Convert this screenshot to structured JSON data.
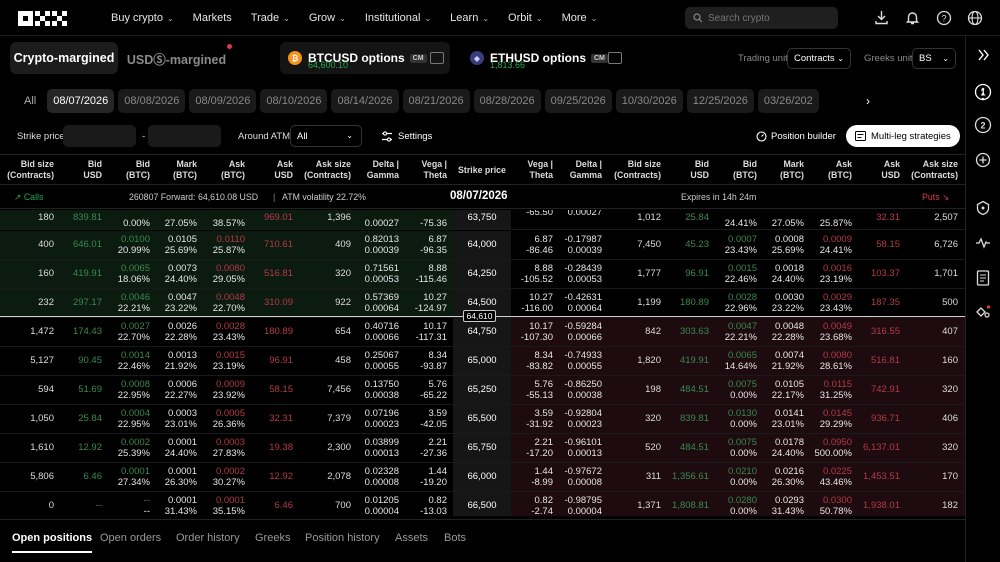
{
  "nav": {
    "items": [
      "Buy crypto",
      "Markets",
      "Trade",
      "Grow",
      "Institutional",
      "Learn",
      "Orbit",
      "More"
    ],
    "has_chevron": [
      true,
      false,
      true,
      true,
      true,
      true,
      true,
      true
    ],
    "search_placeholder": "Search crypto"
  },
  "margin_tabs": {
    "crypto": "Crypto-margined",
    "usd": "USDⓈ-margined"
  },
  "pairs": [
    {
      "name": "BTCUSD options",
      "badge": "CM",
      "price": "64,600.10"
    },
    {
      "name": "ETHUSD options",
      "badge": "CM",
      "price": "1,813.66"
    }
  ],
  "units": {
    "trading_label": "Trading unit",
    "trading_value": "Contracts",
    "greeks_label": "Greeks unit",
    "greeks_value": "BS"
  },
  "dates": [
    "All",
    "08/07/2026",
    "08/08/2026",
    "08/09/2026",
    "08/10/2026",
    "08/14/2026",
    "08/21/2026",
    "08/28/2026",
    "09/25/2026",
    "10/30/2026",
    "12/25/2026",
    "03/26/202"
  ],
  "active_date_index": 1,
  "filters": {
    "strike_label": "Strike price",
    "dash": "-",
    "atm_label": "Around ATM",
    "atm_value": "All",
    "settings": "Settings",
    "position_builder": "Position builder",
    "multi_leg": "Multi-leg strategies"
  },
  "columns": {
    "call": [
      "Bid size\n(Contracts)",
      "Bid\nUSD",
      "Bid\n(BTC)",
      "Mark\n(BTC)",
      "Ask\n(BTC)",
      "Ask\nUSD",
      "Ask size\n(Contracts)",
      "Delta |\nGamma",
      "Vega |\nTheta"
    ],
    "strike": "Strike price",
    "put": [
      "Vega |\nTheta",
      "Delta |\nGamma",
      "Bid size\n(Contracts)",
      "Bid\nUSD",
      "Bid\n(BTC)",
      "Mark\n(BTC)",
      "Ask\n(BTC)",
      "Ask\nUSD",
      "Ask size\n(Contracts)"
    ]
  },
  "infobar": {
    "calls": "Calls",
    "forward": "260807 Forward: 64,610.08 USD",
    "sep": "|",
    "atm_vol": "ATM volatility 22.72%",
    "date": "08/07/2026",
    "expires": "Expires in 14h 24m",
    "puts": "Puts"
  },
  "atm_price": "64,610",
  "rows": [
    {
      "strike": "63,750",
      "call": [
        "180",
        "839.81",
        [
          "",
          "0.00%"
        ],
        [
          "",
          "27.05%"
        ],
        [
          "",
          "38.57%"
        ],
        "969.01",
        "1,396",
        [
          "",
          "0.00027"
        ],
        [
          "",
          "-75.36"
        ]
      ],
      "put": [
        [
          "-65.50",
          ""
        ],
        [
          "0.00027",
          ""
        ],
        "1,012",
        "25.84",
        [
          "",
          "24.41%"
        ],
        [
          "",
          "27.05%"
        ],
        [
          "",
          "25.87%"
        ],
        "32.31",
        "2,507"
      ]
    },
    {
      "strike": "64,000",
      "call": [
        "400",
        "646.01",
        [
          "0.0100",
          "20.99%"
        ],
        [
          "0.0105",
          "25.69%"
        ],
        [
          "0.0110",
          "25.87%"
        ],
        "710.61",
        "409",
        [
          "0.82013",
          "0.00039"
        ],
        [
          "6.87",
          "-96.35"
        ]
      ],
      "put": [
        [
          "6.87",
          "-86.46"
        ],
        [
          "-0.17987",
          "0.00039"
        ],
        "7,450",
        "45.23",
        [
          "0.0007",
          "23.43%"
        ],
        [
          "0.0008",
          "25.69%"
        ],
        [
          "0.0009",
          "24.41%"
        ],
        "58.15",
        "6,726"
      ]
    },
    {
      "strike": "64,250",
      "call": [
        "160",
        "419.91",
        [
          "0.0065",
          "18.06%"
        ],
        [
          "0.0073",
          "24.40%"
        ],
        [
          "0.0080",
          "29.05%"
        ],
        "516.81",
        "320",
        [
          "0.71561",
          "0.00053"
        ],
        [
          "8.88",
          "-115.46"
        ]
      ],
      "put": [
        [
          "8.88",
          "-105.52"
        ],
        [
          "-0.28439",
          "0.00053"
        ],
        "1,777",
        "96.91",
        [
          "0.0015",
          "22.46%"
        ],
        [
          "0.0018",
          "24.40%"
        ],
        [
          "0.0016",
          "23.19%"
        ],
        "103.37",
        "1,701"
      ]
    },
    {
      "strike": "64,500",
      "call": [
        "232",
        "297.17",
        [
          "0.0046",
          "22.21%"
        ],
        [
          "0.0047",
          "23.22%"
        ],
        [
          "0.0048",
          "22.70%"
        ],
        "310.09",
        "922",
        [
          "0.57369",
          "0.00064"
        ],
        [
          "10.27",
          "-124.97"
        ]
      ],
      "put": [
        [
          "10.27",
          "-116.00"
        ],
        [
          "-0.42631",
          "0.00064"
        ],
        "1,199",
        "180.89",
        [
          "0.0028",
          "22.96%"
        ],
        [
          "0.0030",
          "23.22%"
        ],
        [
          "0.0029",
          "23.43%"
        ],
        "187.35",
        "500"
      ]
    },
    {
      "strike": "64,750",
      "call": [
        "1,472",
        "174.43",
        [
          "0.0027",
          "22.70%"
        ],
        [
          "0.0026",
          "22.28%"
        ],
        [
          "0.0028",
          "23.43%"
        ],
        "180.89",
        "654",
        [
          "0.40716",
          "0.00066"
        ],
        [
          "10.17",
          "-117.31"
        ]
      ],
      "put": [
        [
          "10.17",
          "-107.30"
        ],
        [
          "-0.59284",
          "0.00066"
        ],
        "842",
        "303.63",
        [
          "0.0047",
          "22.21%"
        ],
        [
          "0.0048",
          "22.28%"
        ],
        [
          "0.0049",
          "23.68%"
        ],
        "316.55",
        "407"
      ]
    },
    {
      "strike": "65,000",
      "call": [
        "5,127",
        "90.45",
        [
          "0.0014",
          "22.46%"
        ],
        [
          "0.0013",
          "21.92%"
        ],
        [
          "0.0015",
          "23.19%"
        ],
        "96.91",
        "458",
        [
          "0.25067",
          "0.00055"
        ],
        [
          "8.34",
          "-93.87"
        ]
      ],
      "put": [
        [
          "8.34",
          "-83.82"
        ],
        [
          "-0.74933",
          "0.00055"
        ],
        "1,820",
        "419.91",
        [
          "0.0065",
          "14.64%"
        ],
        [
          "0.0074",
          "21.92%"
        ],
        [
          "0.0080",
          "28.61%"
        ],
        "516.81",
        "160"
      ]
    },
    {
      "strike": "65,250",
      "call": [
        "594",
        "51.69",
        [
          "0.0008",
          "22.95%"
        ],
        [
          "0.0006",
          "22.27%"
        ],
        [
          "0.0009",
          "23.92%"
        ],
        "58.15",
        "7,456",
        [
          "0.13750",
          "0.00038"
        ],
        [
          "5.76",
          "-65.22"
        ]
      ],
      "put": [
        [
          "5.76",
          "-55.13"
        ],
        [
          "-0.86250",
          "0.00038"
        ],
        "198",
        "484.51",
        [
          "0.0075",
          "0.00%"
        ],
        [
          "0.0105",
          "22.17%"
        ],
        [
          "0.0115",
          "31.25%"
        ],
        "742.91",
        "320"
      ]
    },
    {
      "strike": "65,500",
      "call": [
        "1,050",
        "25.84",
        [
          "0.0004",
          "22.95%"
        ],
        [
          "0.0003",
          "23.01%"
        ],
        [
          "0.0005",
          "26.36%"
        ],
        "32.31",
        "7,379",
        [
          "0.07196",
          "0.00023"
        ],
        [
          "3.59",
          "-42.05"
        ]
      ],
      "put": [
        [
          "3.59",
          "-31.92"
        ],
        [
          "-0.92804",
          "0.00023"
        ],
        "320",
        "839.81",
        [
          "0.0130",
          "0.00%"
        ],
        [
          "0.0141",
          "23.01%"
        ],
        [
          "0.0145",
          "29.29%"
        ],
        "936.71",
        "406"
      ]
    },
    {
      "strike": "65,750",
      "call": [
        "1,610",
        "12.92",
        [
          "0.0002",
          "25.39%"
        ],
        [
          "0.0001",
          "24.40%"
        ],
        [
          "0.0003",
          "27.83%"
        ],
        "19.38",
        "2,300",
        [
          "0.03899",
          "0.00013"
        ],
        [
          "2.21",
          "-27.36"
        ]
      ],
      "put": [
        [
          "2.21",
          "-17.20"
        ],
        [
          "-0.96101",
          "0.00013"
        ],
        "520",
        "484.51",
        [
          "0.0075",
          "0.00%"
        ],
        [
          "0.0178",
          "24.40%"
        ],
        [
          "0.0950",
          "500.00%"
        ],
        "6,137.01",
        "320"
      ]
    },
    {
      "strike": "66,000",
      "call": [
        "5,806",
        "6.46",
        [
          "0.0001",
          "27.34%"
        ],
        [
          "0.0001",
          "26.30%"
        ],
        [
          "0.0002",
          "30.27%"
        ],
        "12.92",
        "2,078",
        [
          "0.02328",
          "0.00008"
        ],
        [
          "1.44",
          "-19.20"
        ]
      ],
      "put": [
        [
          "1.44",
          "-8.99"
        ],
        [
          "-0.97672",
          "0.00008"
        ],
        "311",
        "1,356.61",
        [
          "0.0210",
          "0.00%"
        ],
        [
          "0.0216",
          "26.30%"
        ],
        [
          "0.0225",
          "43.46%"
        ],
        "1,453.51",
        "170"
      ]
    },
    {
      "strike": "66,500",
      "call": [
        "0",
        "--",
        [
          "--",
          "--"
        ],
        [
          "0.0001",
          "31.43%"
        ],
        [
          "0.0001",
          "35.15%"
        ],
        "6.46",
        "700",
        [
          "0.01205",
          "0.00004"
        ],
        [
          "0.82",
          "-13.03"
        ]
      ],
      "put": [
        [
          "0.82",
          "-2.74"
        ],
        [
          "-0.98795",
          "0.00004"
        ],
        "1,371",
        "1,808.81",
        [
          "0.0280",
          "0.00%"
        ],
        [
          "0.0293",
          "31.43%"
        ],
        [
          "0.0300",
          "50.78%"
        ],
        "1,938.01",
        "182"
      ]
    }
  ],
  "bottom_tabs": [
    "Open positions",
    "Open orders",
    "Order history",
    "Greeks",
    "Position history",
    "Assets",
    "Bots"
  ],
  "right_bar": [
    "close-panel-icon",
    "more-icon",
    "step-1-icon",
    "step-2-icon",
    "add-icon",
    "shield-icon",
    "pulse-icon",
    "document-icon",
    "strategy-icon"
  ],
  "colors": {
    "green": "#25a750",
    "red": "#e2364a",
    "call_bg": "#0b1b10",
    "put_bg": "#1d0b0f",
    "orange": "#f7931a",
    "eth": "#8a92d8"
  }
}
